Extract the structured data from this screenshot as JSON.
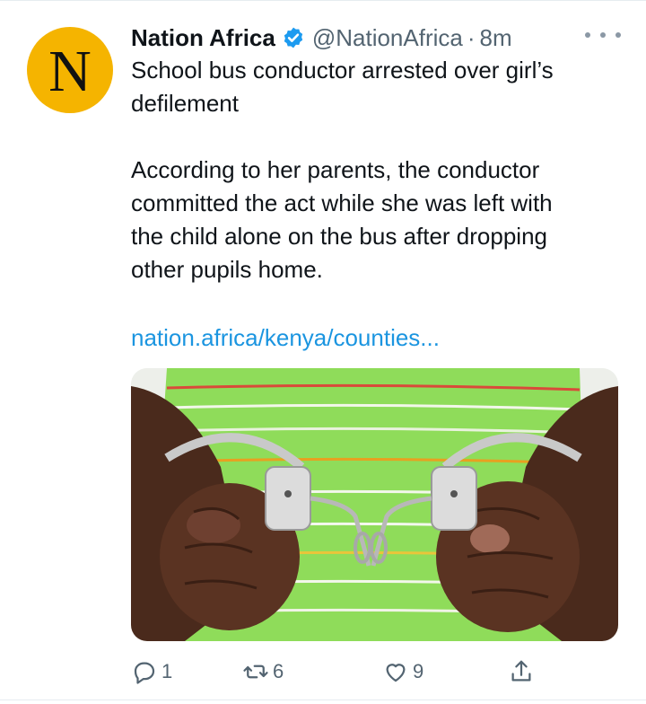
{
  "account": {
    "avatar_letter": "N",
    "avatar_color": "#f5b400",
    "display_name": "Nation Africa",
    "verified": true,
    "handle": "@NationAfrica",
    "separator": "·",
    "timestamp": "8m"
  },
  "tweet": {
    "headline_lines": [
      "School bus conductor arrested over girl’s",
      "defilement"
    ],
    "body_lines": [
      "According to her parents, the conductor",
      "committed the act while she was left with",
      "the child alone on the bus after dropping",
      "other pupils home."
    ],
    "link": "nation.africa/kenya/counties..."
  },
  "media": {
    "image_icon": "handcuffed-hands-photo"
  },
  "actions": {
    "reply_icon": "reply-icon",
    "reply_count": "1",
    "retweet_icon": "retweet-icon",
    "retweet_count": "6",
    "like_icon": "heart-icon",
    "like_count": "9",
    "share_icon": "share-icon"
  },
  "colors": {
    "link": "#1b95e0",
    "secondary_text": "#536471",
    "verified_badge": "#1d9bf0"
  }
}
